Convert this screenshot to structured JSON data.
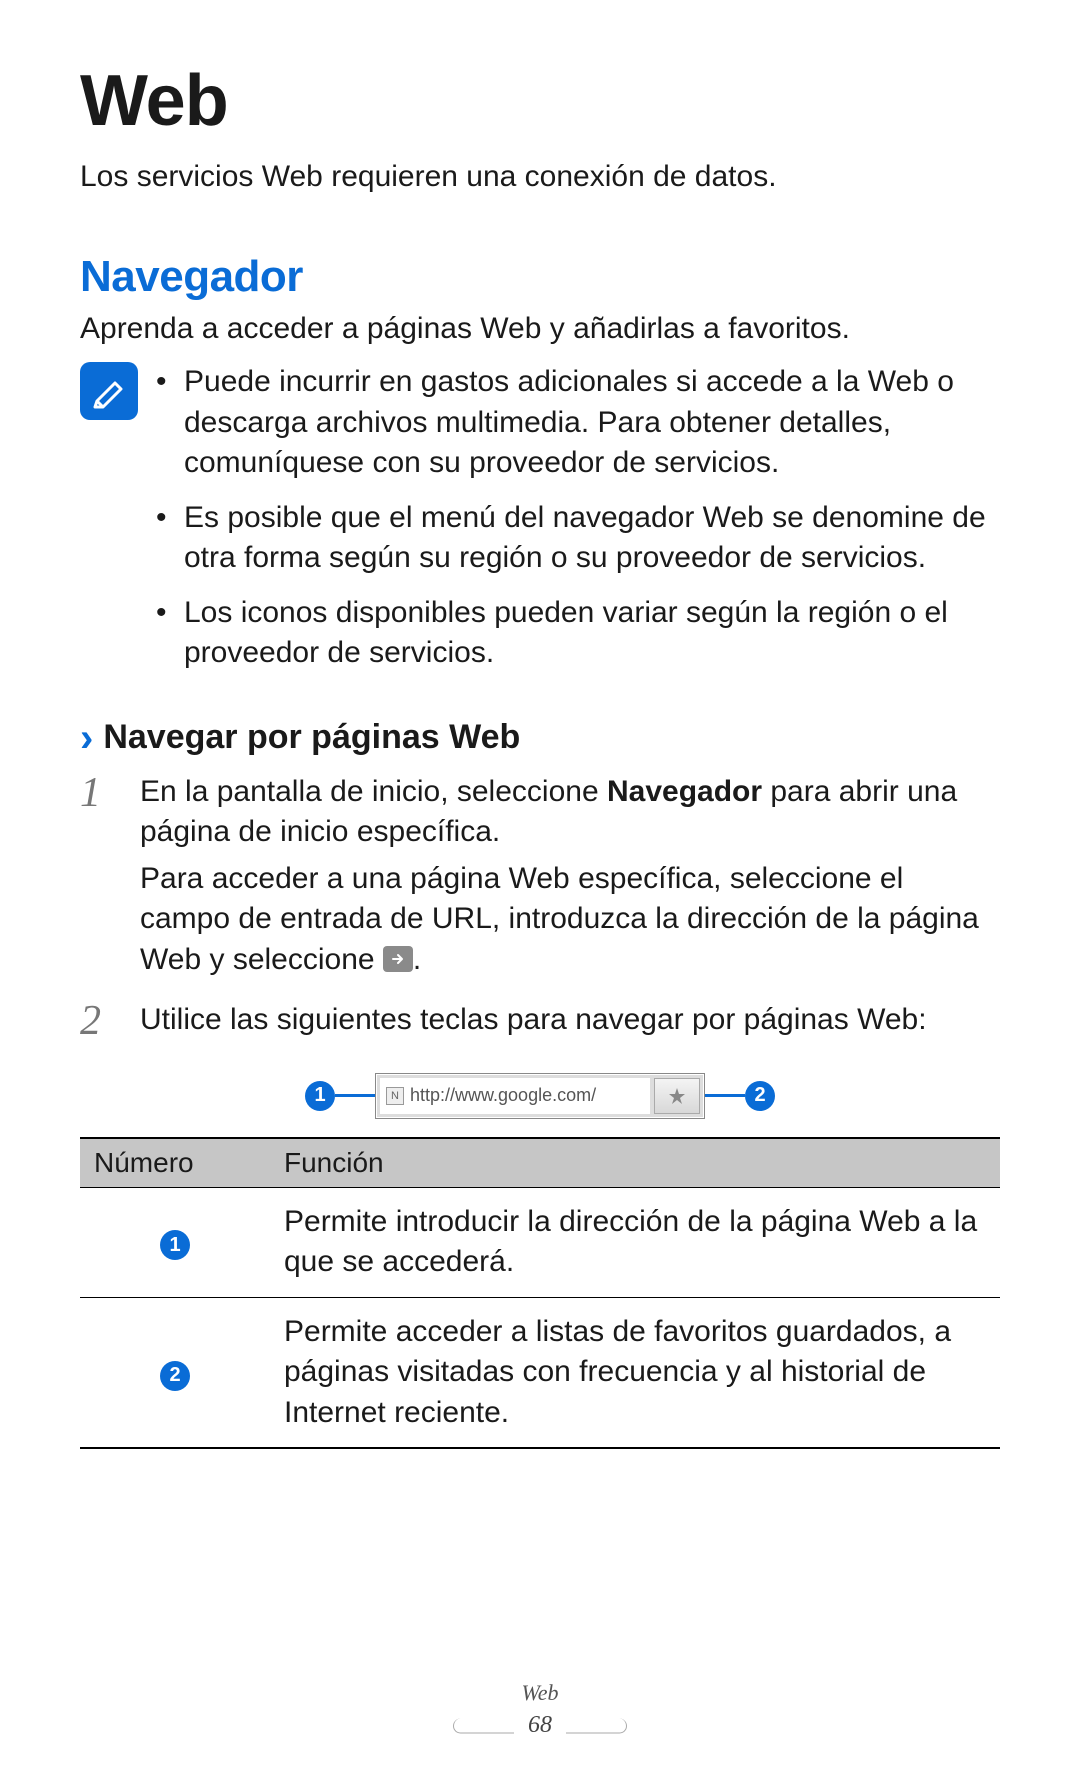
{
  "title": "Web",
  "intro": "Los servicios Web requieren una conexión de datos.",
  "section_heading": "Navegador",
  "section_sub": "Aprenda a acceder a páginas Web y añadirlas a favoritos.",
  "notes": [
    "Puede incurrir en gastos adicionales si accede a la Web o descarga archivos multimedia. Para obtener detalles, comuníquese con su proveedor de servicios.",
    "Es posible que el menú del navegador Web se denomine de otra forma según su región o su proveedor de servicios.",
    "Los iconos disponibles pueden variar según la región o el proveedor de servicios."
  ],
  "subsection_heading": "Navegar por páginas Web",
  "steps": {
    "s1_num": "1",
    "s1_a_pre": "En la pantalla de inicio, seleccione ",
    "s1_a_bold": "Navegador",
    "s1_a_post": " para abrir una página de inicio específica.",
    "s1_b_pre": "Para acceder a una página Web específica, seleccione el campo de entrada de URL, introduzca la dirección de la página Web y seleccione ",
    "s1_b_post": ".",
    "s2_num": "2",
    "s2_text": "Utilice las siguientes teclas para navegar por páginas Web:"
  },
  "diagram": {
    "callout1": "1",
    "url": "http://www.google.com/",
    "callout2": "2"
  },
  "table": {
    "h1": "Número",
    "h2": "Función",
    "rows": [
      {
        "num": "1",
        "desc": "Permite introducir la dirección de la página Web a la que se accederá."
      },
      {
        "num": "2",
        "desc": "Permite acceder a listas de favoritos guardados, a páginas visitadas con frecuencia y al historial de Internet reciente."
      }
    ]
  },
  "footer_title": "Web",
  "footer_page": "68"
}
